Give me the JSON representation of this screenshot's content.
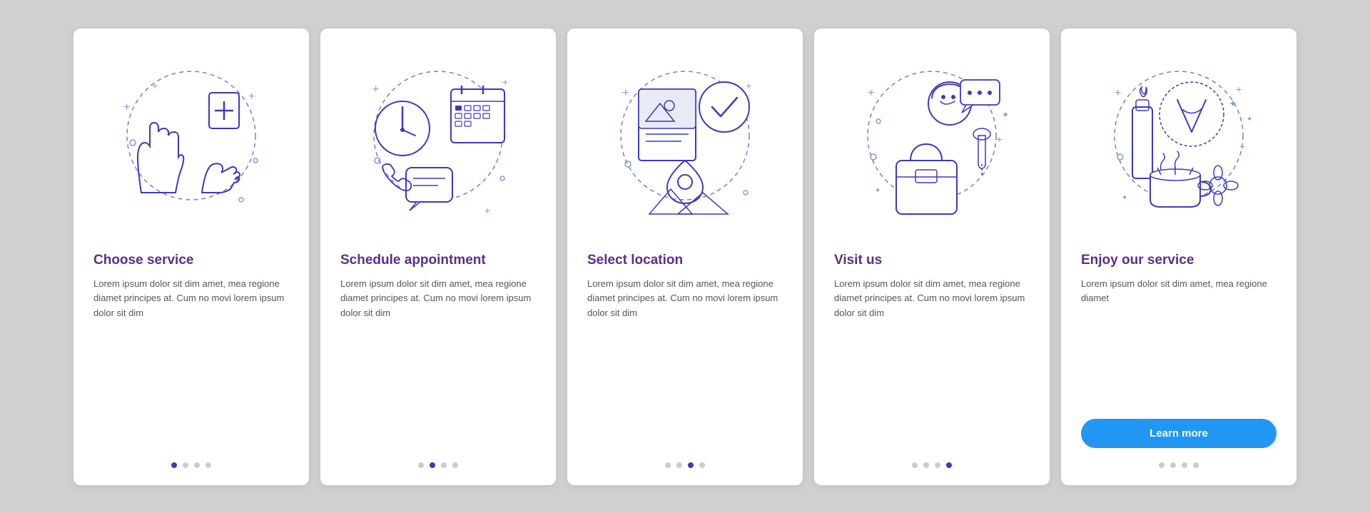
{
  "cards": [
    {
      "id": "choose-service",
      "title": "Choose service",
      "text": "Lorem ipsum dolor sit dim amet, mea regione diamet principes at. Cum no movi lorem ipsum dolor sit dim",
      "dots": [
        true,
        false,
        false,
        false
      ],
      "active_dot": 0,
      "button": null
    },
    {
      "id": "schedule-appointment",
      "title": "Schedule appointment",
      "text": "Lorem ipsum dolor sit dim amet, mea regione diamet principes at. Cum no movi lorem ipsum dolor sit dim",
      "dots": [
        false,
        true,
        false,
        false
      ],
      "active_dot": 1,
      "button": null
    },
    {
      "id": "select-location",
      "title": "Select location",
      "text": "Lorem ipsum dolor sit dim amet, mea regione diamet principes at. Cum no movi lorem ipsum dolor sit dim",
      "dots": [
        false,
        false,
        true,
        false
      ],
      "active_dot": 2,
      "button": null
    },
    {
      "id": "visit-us",
      "title": "Visit us",
      "text": "Lorem ipsum dolor sit dim amet, mea regione diamet principes at. Cum no movi lorem ipsum dolor sit dim",
      "dots": [
        false,
        false,
        false,
        true
      ],
      "active_dot": 3,
      "button": null
    },
    {
      "id": "enjoy-service",
      "title": "Enjoy our service",
      "text": "Lorem ipsum dolor sit dim amet, mea regione diamet",
      "dots": [
        false,
        false,
        false,
        false
      ],
      "active_dot": -1,
      "button": "Learn more"
    }
  ]
}
